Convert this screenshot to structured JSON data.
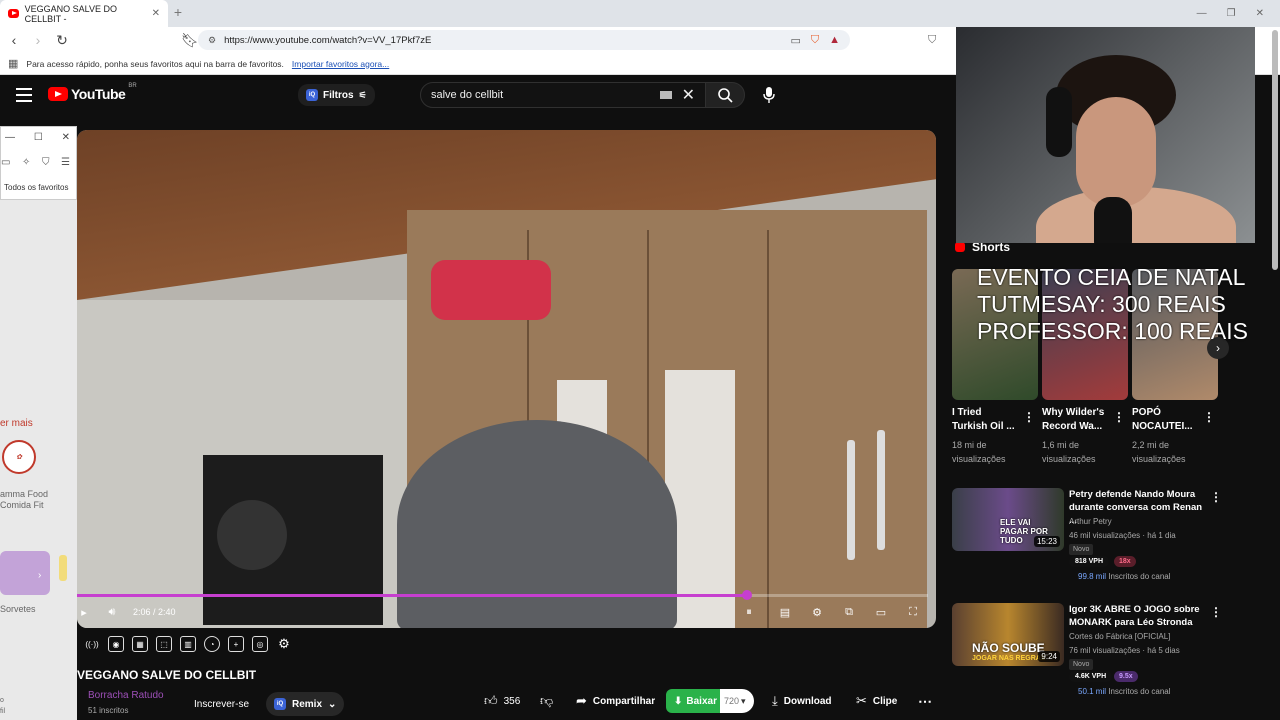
{
  "browser": {
    "tab_title": "VEGGANO SALVE DO CELLBIT -",
    "url": "https://www.youtube.com/watch?v=VV_17Pkf7zE",
    "bookmarks_hint": "Para acesso rápido, ponha seus favoritos aqui na barra de favoritos.",
    "bookmarks_link": "Importar favoritos agora..."
  },
  "youtube": {
    "logo_text": "YouTube",
    "logo_region": "BR",
    "filters_label": "Filtros",
    "search_value": "salve do cellbit"
  },
  "side_panel": {
    "favorites_label": "Todos os favoritos",
    "ver_mais": "er mais",
    "card1_name_line1": "amma Food",
    "card1_name_line2": "Comida Fit",
    "card2_name": "Sorvetes",
    "bottom_line1": "o",
    "bottom_line2": "fil"
  },
  "player": {
    "time": "2:06 / 2:40",
    "progress_fraction": 0.7875
  },
  "video": {
    "title": "VEGGANO SALVE DO CELLBIT",
    "channel": "Borracha Ratudo",
    "subscribers": "51 inscritos",
    "subscribe_label": "Inscrever-se",
    "remix_label": "Remix",
    "likes": "356",
    "share_label": "Compartilhar",
    "baixar_label": "Baixar",
    "quality": "720",
    "download_label": "Download",
    "clip_label": "Clipe"
  },
  "shorts": {
    "section_label": "Shorts",
    "overlay_lines": [
      "EVENTO CEIA DE NATAL",
      "TUTMESAY: 300 REAIS",
      "PROFESSOR: 100 REAIS"
    ],
    "items": [
      {
        "title_l1": "I Tried",
        "title_l2": "Turkish Oil ...",
        "views_l1": "18 mi de",
        "views_l2": "visualizações"
      },
      {
        "title_l1": "Why Wilder's",
        "title_l2": "Record Wa...",
        "views_l1": "1,6 mi de",
        "views_l2": "visualizações"
      },
      {
        "title_l1": "POPÓ",
        "title_l2": "NOCAUTEI...",
        "views_l1": "2,2 mi de",
        "views_l2": "visualizações"
      }
    ]
  },
  "recommendations": [
    {
      "title_l1": "Petry defende Nando Moura",
      "title_l2": "durante conversa com Renan ...",
      "channel": "Arthur Petry",
      "meta": "46 mil visualizações · há 1 dia",
      "badge": "Novo",
      "duration": "15:23",
      "vph": "818 VPH",
      "mult": "18x",
      "subs_value": "99.8 mil",
      "subs_label": "Inscritos do canal",
      "thumb_text": "ELE VAI PAGAR POR TUDO"
    },
    {
      "title_l1": "Igor 3K ABRE O JOGO sobre",
      "title_l2": "MONARK para Léo Stronda",
      "channel": "Cortes do Fábrica [OFICIAL]",
      "meta": "76 mil visualizações · há 5 dias",
      "badge": "Novo",
      "duration": "9:24",
      "vph": "4.6K VPH",
      "mult": "9.5x",
      "subs_value": "50.1 mil",
      "subs_label": "Inscritos do canal",
      "thumb_text_l1": "NÃO SOUBE",
      "thumb_text_l2": "JOGAR NAS REGRAS"
    }
  ],
  "colors": {
    "progress": "#c63fcf",
    "baixar": "#2ab24a",
    "youtube_red": "#ff0000"
  }
}
